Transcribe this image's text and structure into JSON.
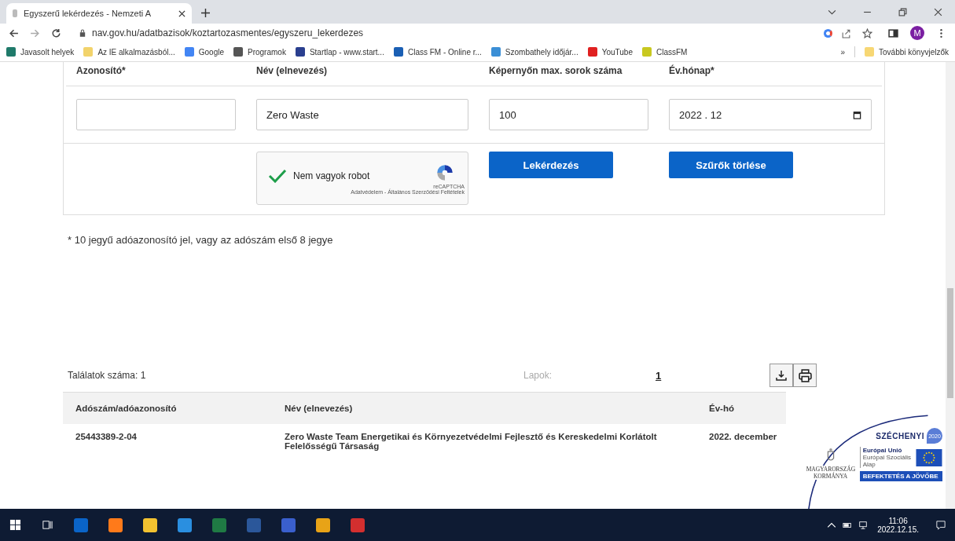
{
  "browser": {
    "tab": {
      "title": "Egyszerű lekérdezés - Nemzeti A"
    },
    "url": "nav.gov.hu/adatbazisok/koztartozasmentes/egyszeru_lekerdezes",
    "profile": "M",
    "bookmarks": [
      {
        "label": "Javasolt helyek",
        "color": "#1f7a6a"
      },
      {
        "label": "Az IE alkalmazásból...",
        "color": "#f2d36b"
      },
      {
        "label": "Google",
        "color": "#4285f4"
      },
      {
        "label": "Programok",
        "color": "#555555"
      },
      {
        "label": "Startlap - www.start...",
        "color": "#2a3f8f"
      },
      {
        "label": "Class FM - Online r...",
        "color": "#1a5fb4"
      },
      {
        "label": "Szombathely időjár...",
        "color": "#3b8fd6"
      },
      {
        "label": "YouTube",
        "color": "#e02020"
      },
      {
        "label": "ClassFM",
        "color": "#c8c820"
      }
    ],
    "more_bookmarks": "»",
    "other_bookmarks": "További könyvjelzők"
  },
  "form": {
    "fields": [
      {
        "label": "Azonosító*",
        "kind": "text"
      },
      {
        "label": "Név (elnevezés)",
        "value": "Zero Waste",
        "kind": "text"
      },
      {
        "label": "Képernyőn max. sorok száma",
        "value": "100",
        "kind": "text"
      },
      {
        "label": "Év.hónap*",
        "value": "2022 . 12",
        "kind": "month"
      }
    ],
    "captcha": {
      "label": "Nem vagyok robot",
      "checked": true,
      "brand": "reCAPTCHA",
      "links": "Adatvédelem - Általános Szerződési Feltételek"
    },
    "buttons": [
      "Lekérdezés",
      "Szűrők törlése"
    ],
    "footnote": "* 10 jegyű adóazonosító jel, vagy az adószám első 8 jegye"
  },
  "results": {
    "count": "Találatok száma: 1",
    "pages_label": "Lapok:",
    "pages": [
      {
        "label": "1",
        "selected": true
      }
    ],
    "table": {
      "columns": [
        "Adószám/adóazonosító",
        "Név (elnevezés)",
        "Év-hó"
      ],
      "rows": [
        [
          "25443389-2-04",
          "Zero Waste Team Energetikai és Környezetvédelmi Fejlesztő és Kereskedelmi Korlátolt Felelősségű Társaság",
          "2022. december"
        ]
      ]
    }
  },
  "logo": {
    "title": "SZÉCHENYI",
    "year": "2020",
    "eu_lines": [
      "Európai Unió",
      "Európai Szociális",
      "Alap"
    ],
    "gov": "MAGYARORSZÁG KORMÁNYA",
    "slogan": "BEFEKTETÉS A JÖVŐBE"
  },
  "taskbar": {
    "time": "11:06",
    "date": "2022.12.15."
  }
}
